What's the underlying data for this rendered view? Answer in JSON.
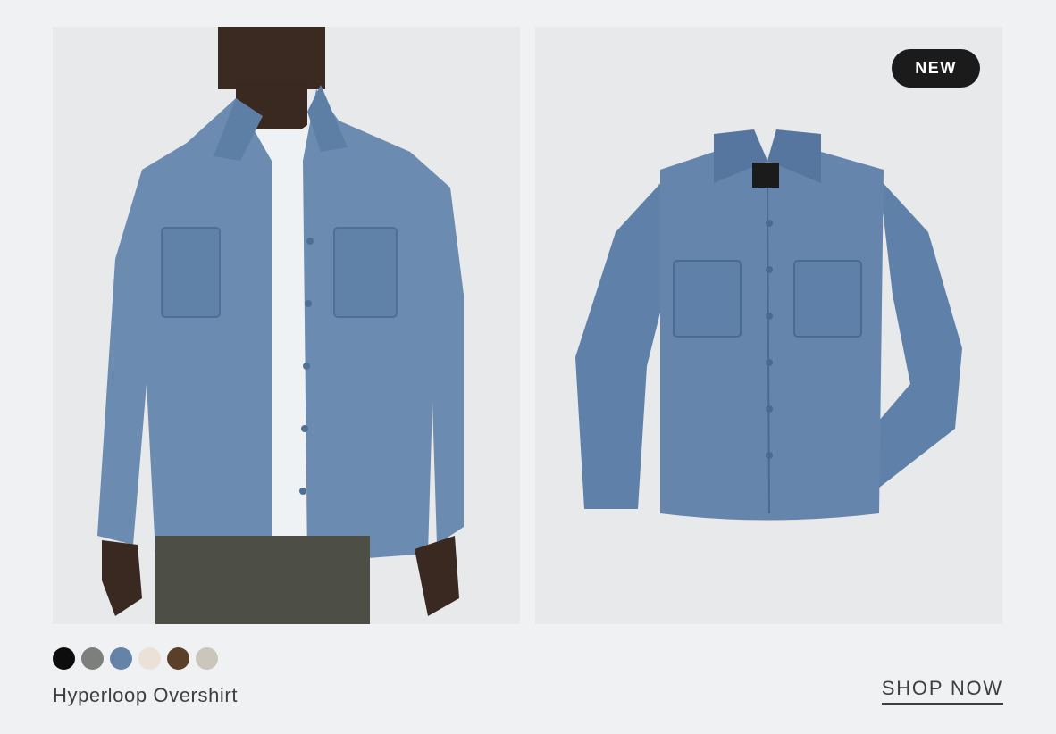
{
  "product": {
    "name": "Hyperloop Overshirt",
    "badge": "NEW",
    "cta_label": "SHOP NOW",
    "swatches": [
      {
        "name": "black",
        "color": "#0d0d0d"
      },
      {
        "name": "grey",
        "color": "#7d7f7c"
      },
      {
        "name": "blue",
        "color": "#6483a6"
      },
      {
        "name": "cream",
        "color": "#ece1d6"
      },
      {
        "name": "brown",
        "color": "#5b4029"
      },
      {
        "name": "stone",
        "color": "#cbc6bc"
      }
    ]
  },
  "colors": {
    "shirt_blue": "#6b8bb0",
    "shirt_blue_dark": "#4f6f95",
    "background": "#f0f1f3",
    "panel": "#e8e9eb"
  }
}
